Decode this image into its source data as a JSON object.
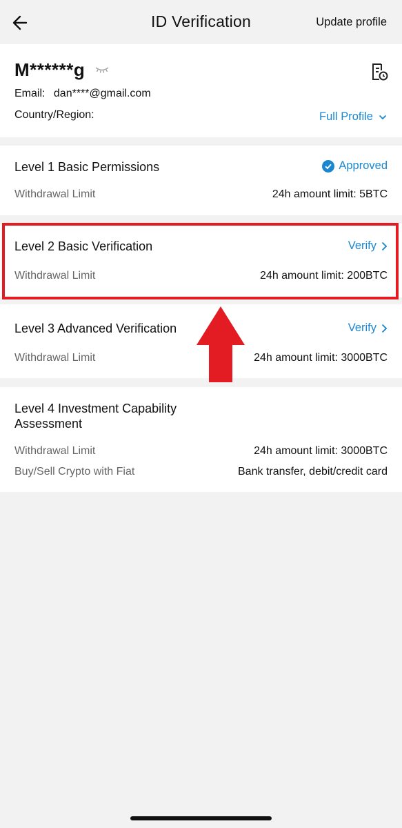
{
  "header": {
    "title": "ID Verification",
    "update_profile": "Update profile"
  },
  "profile": {
    "username": "M******g",
    "email_label": "Email:",
    "email_value": "dan****@gmail.com",
    "country_label": "Country/Region:",
    "full_profile": "Full Profile"
  },
  "levels": [
    {
      "title": "Level 1 Basic Permissions",
      "status": "Approved",
      "rows": [
        {
          "label": "Withdrawal Limit",
          "value": "24h amount limit: 5BTC"
        }
      ]
    },
    {
      "title": "Level 2 Basic Verification",
      "status": "Verify",
      "rows": [
        {
          "label": "Withdrawal Limit",
          "value": "24h amount limit: 200BTC"
        }
      ]
    },
    {
      "title": "Level 3 Advanced Verification",
      "status": "Verify",
      "rows": [
        {
          "label": "Withdrawal Limit",
          "value": "24h amount limit: 3000BTC"
        }
      ]
    },
    {
      "title_line1": "Level 4 Investment Capability",
      "title_line2": "Assessment",
      "rows": [
        {
          "label": "Withdrawal Limit",
          "value": "24h amount limit: 3000BTC"
        },
        {
          "label": "Buy/Sell Crypto with Fiat",
          "value": "Bank transfer, debit/credit card"
        }
      ]
    }
  ],
  "colors": {
    "accent": "#1a86d0",
    "highlight": "#e31b23",
    "background": "#f2f2f2"
  }
}
